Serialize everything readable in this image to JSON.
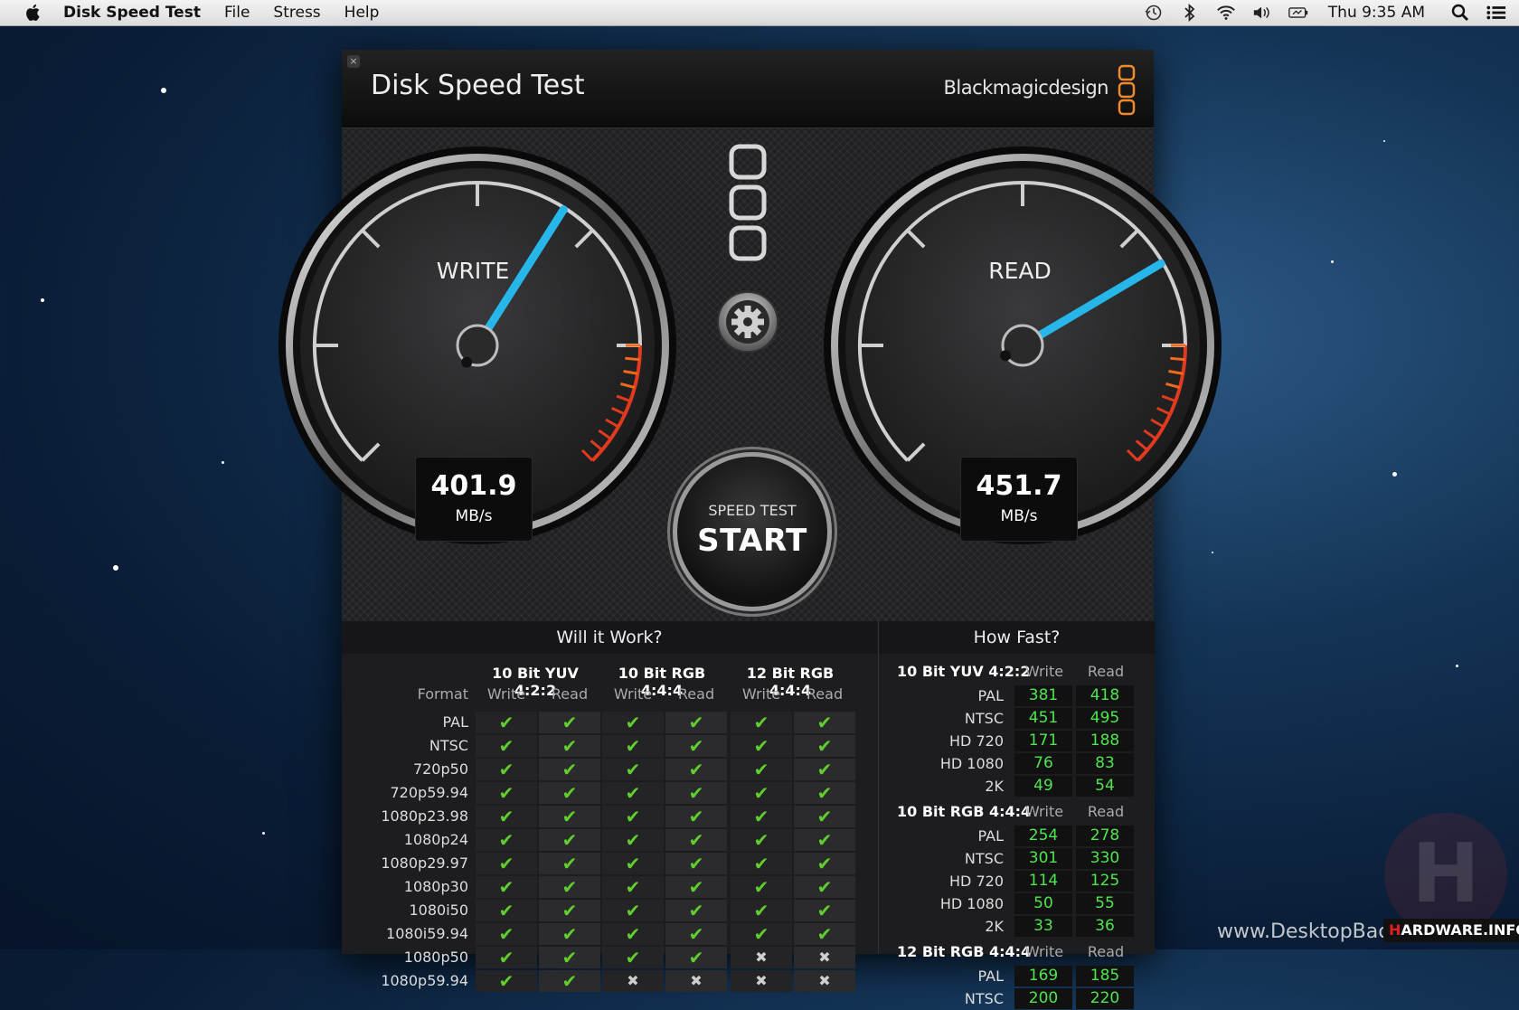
{
  "menubar": {
    "app_name": "Disk Speed Test",
    "menus": [
      "File",
      "Stress",
      "Help"
    ],
    "clock": "Thu 9:35 AM"
  },
  "window": {
    "title": "Disk Speed Test",
    "brand": "Blackmagicdesign",
    "close_glyph": "×"
  },
  "gauges": {
    "write": {
      "label": "WRITE",
      "value": "401.9",
      "unit": "MB/s",
      "needle_fraction": 0.62
    },
    "read": {
      "label": "READ",
      "value": "451.7",
      "unit": "MB/s",
      "needle_fraction": 0.72
    }
  },
  "start_button": {
    "small": "SPEED TEST",
    "big": "START"
  },
  "will_it_work": {
    "title": "Will it Work?",
    "format_label": "Format",
    "groups": [
      "10 Bit YUV 4:2:2",
      "10 Bit RGB 4:4:4",
      "12 Bit RGB 4:4:4"
    ],
    "sub_headers": [
      "Write",
      "Read"
    ],
    "rows": [
      {
        "format": "PAL",
        "cells": [
          true,
          true,
          true,
          true,
          true,
          true
        ]
      },
      {
        "format": "NTSC",
        "cells": [
          true,
          true,
          true,
          true,
          true,
          true
        ]
      },
      {
        "format": "720p50",
        "cells": [
          true,
          true,
          true,
          true,
          true,
          true
        ]
      },
      {
        "format": "720p59.94",
        "cells": [
          true,
          true,
          true,
          true,
          true,
          true
        ]
      },
      {
        "format": "1080p23.98",
        "cells": [
          true,
          true,
          true,
          true,
          true,
          true
        ]
      },
      {
        "format": "1080p24",
        "cells": [
          true,
          true,
          true,
          true,
          true,
          true
        ]
      },
      {
        "format": "1080p29.97",
        "cells": [
          true,
          true,
          true,
          true,
          true,
          true
        ]
      },
      {
        "format": "1080p30",
        "cells": [
          true,
          true,
          true,
          true,
          true,
          true
        ]
      },
      {
        "format": "1080i50",
        "cells": [
          true,
          true,
          true,
          true,
          true,
          true
        ]
      },
      {
        "format": "1080i59.94",
        "cells": [
          true,
          true,
          true,
          true,
          true,
          true
        ]
      },
      {
        "format": "1080p50",
        "cells": [
          true,
          true,
          true,
          true,
          false,
          false
        ]
      },
      {
        "format": "1080p59.94",
        "cells": [
          true,
          true,
          false,
          false,
          false,
          false
        ]
      }
    ]
  },
  "how_fast": {
    "title": "How Fast?",
    "write_label": "Write",
    "read_label": "Read",
    "groups": [
      {
        "name": "10 Bit YUV 4:2:2",
        "rows": [
          {
            "format": "PAL",
            "write": "381",
            "read": "418"
          },
          {
            "format": "NTSC",
            "write": "451",
            "read": "495"
          },
          {
            "format": "HD 720",
            "write": "171",
            "read": "188"
          },
          {
            "format": "HD 1080",
            "write": "76",
            "read": "83"
          },
          {
            "format": "2K",
            "write": "49",
            "read": "54"
          }
        ]
      },
      {
        "name": "10 Bit RGB 4:4:4",
        "rows": [
          {
            "format": "PAL",
            "write": "254",
            "read": "278"
          },
          {
            "format": "NTSC",
            "write": "301",
            "read": "330"
          },
          {
            "format": "HD 720",
            "write": "114",
            "read": "125"
          },
          {
            "format": "HD 1080",
            "write": "50",
            "read": "55"
          },
          {
            "format": "2K",
            "write": "33",
            "read": "36"
          }
        ]
      },
      {
        "name": "12 Bit RGB 4:4:4",
        "rows": [
          {
            "format": "PAL",
            "write": "169",
            "read": "185"
          },
          {
            "format": "NTSC",
            "write": "200",
            "read": "220"
          }
        ]
      }
    ]
  },
  "watermark": {
    "text": "www.DesktopBackground.org",
    "badge_h": "H",
    "badge_rest": "ARDWARE.INFO"
  },
  "colors": {
    "accent_blue": "#26b6ea",
    "check_green": "#5fcf2e",
    "value_green": "#4ee54e",
    "brand_orange": "#f08a2c",
    "redline": "#e23a1e"
  }
}
